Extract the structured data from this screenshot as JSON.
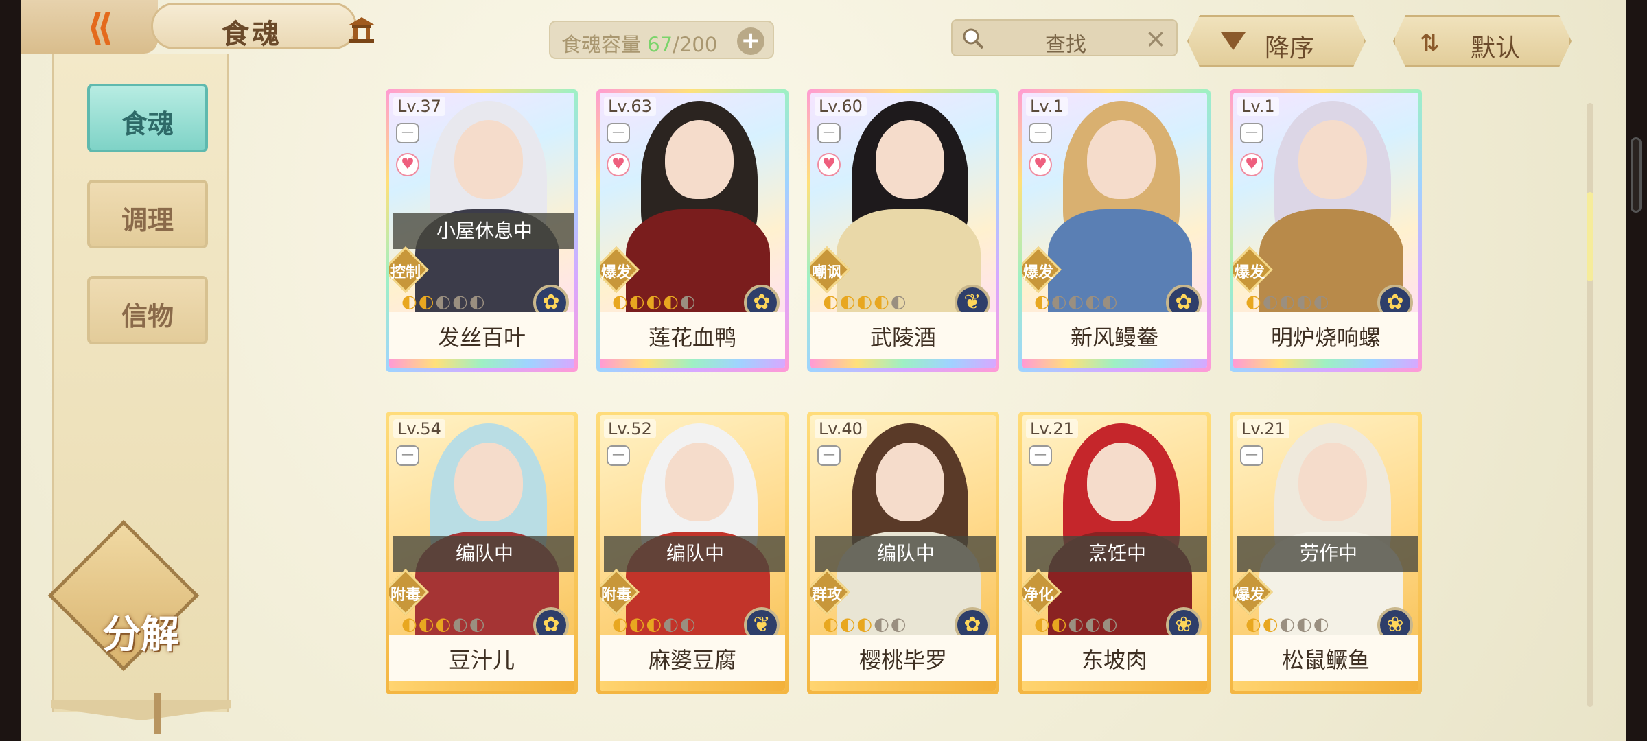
{
  "header": {
    "back_icon": "back-arrow-icon",
    "title": "食魂",
    "home_icon": "pavilion-icon",
    "capacity": {
      "label": "食魂容量",
      "current": "67",
      "max": "/200",
      "plus": "+"
    },
    "search": {
      "text": "查找",
      "clear": "×"
    },
    "sort_label": "降序",
    "default_label": "默认"
  },
  "sidebar": {
    "items": [
      {
        "label": "食魂",
        "active": true
      },
      {
        "label": "调理",
        "active": false
      },
      {
        "label": "信物",
        "active": false
      }
    ],
    "decompose_label": "分解"
  },
  "colors": {
    "accent_teal": "#7fd3c7",
    "gold": "#f4b642",
    "capacity_current": "#7bd46b"
  },
  "cards": [
    {
      "level": "Lv.37",
      "name": "发丝百叶",
      "status": "小屋休息中",
      "type": "控制",
      "stars_on": 2,
      "stars_total": 5,
      "rarity": "rainbow",
      "heart": true,
      "hair": "#e8e8ee",
      "body": "#3c3c4a",
      "orb": "✿"
    },
    {
      "level": "Lv.63",
      "name": "莲花血鸭",
      "status": "",
      "type": "爆发",
      "stars_on": 4,
      "stars_total": 5,
      "rarity": "rainbow",
      "heart": true,
      "hair": "#2b2420",
      "body": "#7a1d1d",
      "orb": "✿"
    },
    {
      "level": "Lv.60",
      "name": "武陵酒",
      "status": "",
      "type": "嘲讽",
      "stars_on": 4,
      "stars_total": 5,
      "rarity": "rainbow",
      "heart": true,
      "hair": "#1e1a1c",
      "body": "#e9d8a8",
      "orb": "❦"
    },
    {
      "level": "Lv.1",
      "name": "新风鳗鲞",
      "status": "",
      "type": "爆发",
      "stars_on": 1,
      "stars_total": 5,
      "rarity": "rainbow",
      "heart": true,
      "hair": "#d9b070",
      "body": "#5a7fb4",
      "orb": "✿"
    },
    {
      "level": "Lv.1",
      "name": "明炉烧响螺",
      "status": "",
      "type": "爆发",
      "stars_on": 1,
      "stars_total": 5,
      "rarity": "rainbow",
      "heart": true,
      "hair": "#dcd6e6",
      "body": "#b88a4a",
      "orb": "✿"
    },
    {
      "level": "Lv.54",
      "name": "豆汁儿",
      "status": "编队中",
      "type": "附毒",
      "stars_on": 3,
      "stars_total": 5,
      "rarity": "gold",
      "heart": false,
      "hair": "#b9dde4",
      "body": "#a53434",
      "orb": "✿"
    },
    {
      "level": "Lv.52",
      "name": "麻婆豆腐",
      "status": "编队中",
      "type": "附毒",
      "stars_on": 3,
      "stars_total": 5,
      "rarity": "gold",
      "heart": false,
      "hair": "#f2f2f2",
      "body": "#c2342a",
      "orb": "❦"
    },
    {
      "level": "Lv.40",
      "name": "樱桃毕罗",
      "status": "编队中",
      "type": "群攻",
      "stars_on": 3,
      "stars_total": 5,
      "rarity": "gold",
      "heart": false,
      "hair": "#5a3a28",
      "body": "#e9e5d4",
      "orb": "✿"
    },
    {
      "level": "Lv.21",
      "name": "东坡肉",
      "status": "烹饪中",
      "type": "净化",
      "stars_on": 2,
      "stars_total": 5,
      "rarity": "gold",
      "heart": false,
      "hair": "#c5262b",
      "body": "#8a2222",
      "orb": "❀"
    },
    {
      "level": "Lv.21",
      "name": "松鼠鳜鱼",
      "status": "劳作中",
      "type": "爆发",
      "stars_on": 2,
      "stars_total": 5,
      "rarity": "gold",
      "heart": false,
      "hair": "#efe9dc",
      "body": "#f4f1e6",
      "orb": "❀"
    }
  ]
}
